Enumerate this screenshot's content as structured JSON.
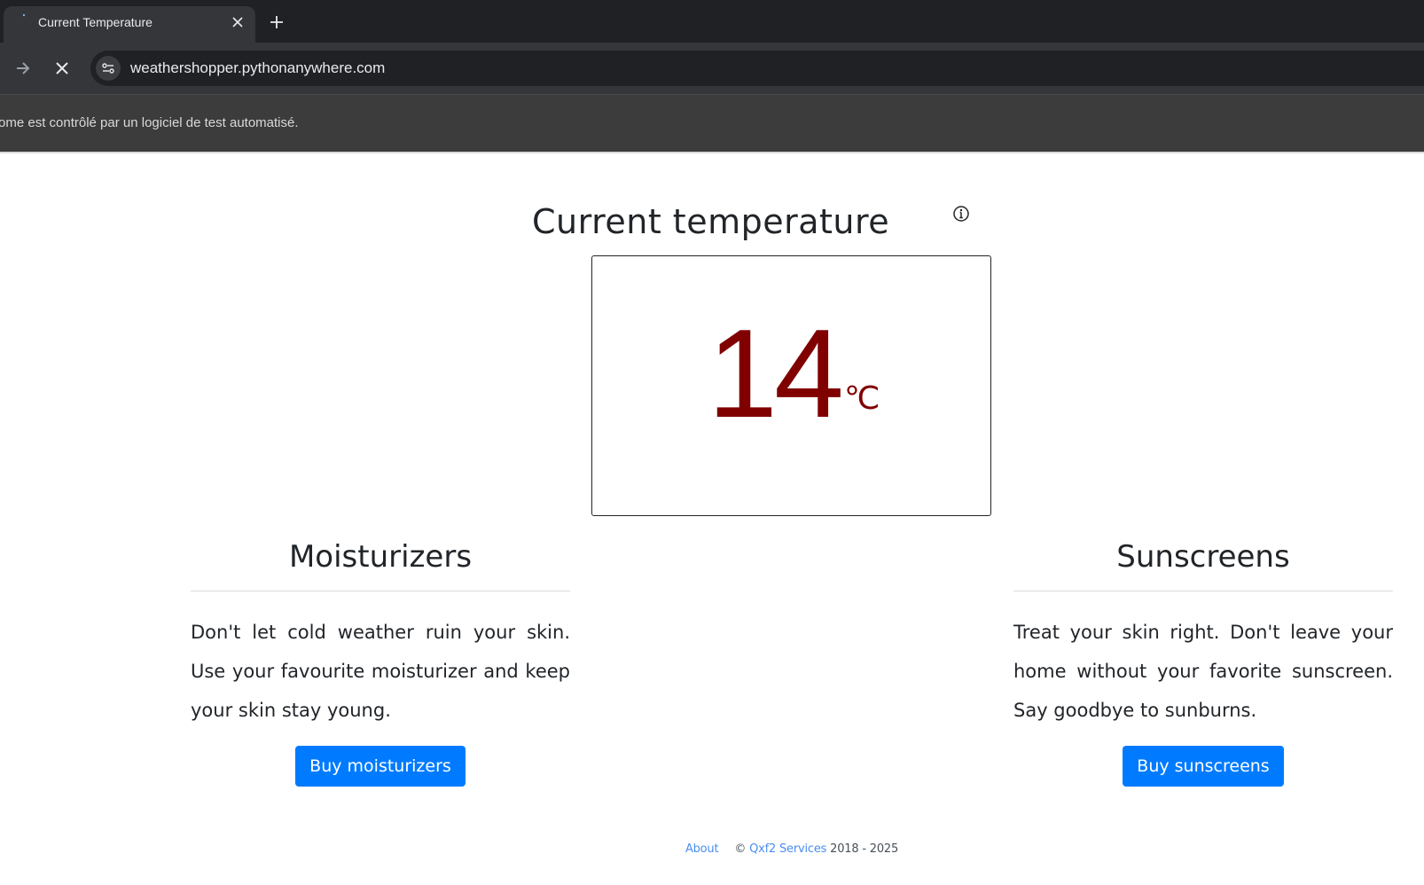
{
  "browser": {
    "tab_title": "Current Temperature",
    "url": "weathershopper.pythonanywhere.com",
    "infobar_text": "ome est contrôlé par un logiciel de test automatisé."
  },
  "page": {
    "title": "Current temperature",
    "temperature_value": "14",
    "temperature_unit": "℃",
    "temperature_color": "#800000"
  },
  "moisturizers": {
    "heading": "Moisturizers",
    "text": "Don't let cold weather ruin your skin. Use your favourite moisturizer and keep your skin stay young.",
    "button_label": "Buy moisturizers"
  },
  "sunscreens": {
    "heading": "Sunscreens",
    "text": "Treat your skin right. Don't leave your home without your favorite sunscreen. Say goodbye to sunburns.",
    "button_label": "Buy sunscreens"
  },
  "footer": {
    "about_label": "About",
    "copyright_symbol": "©",
    "company_link": "Qxf2 Services",
    "years": "2018 - 2025"
  },
  "colors": {
    "button_primary": "#007bff",
    "link": "#4a8ef0",
    "chrome_dark": "#202124"
  }
}
